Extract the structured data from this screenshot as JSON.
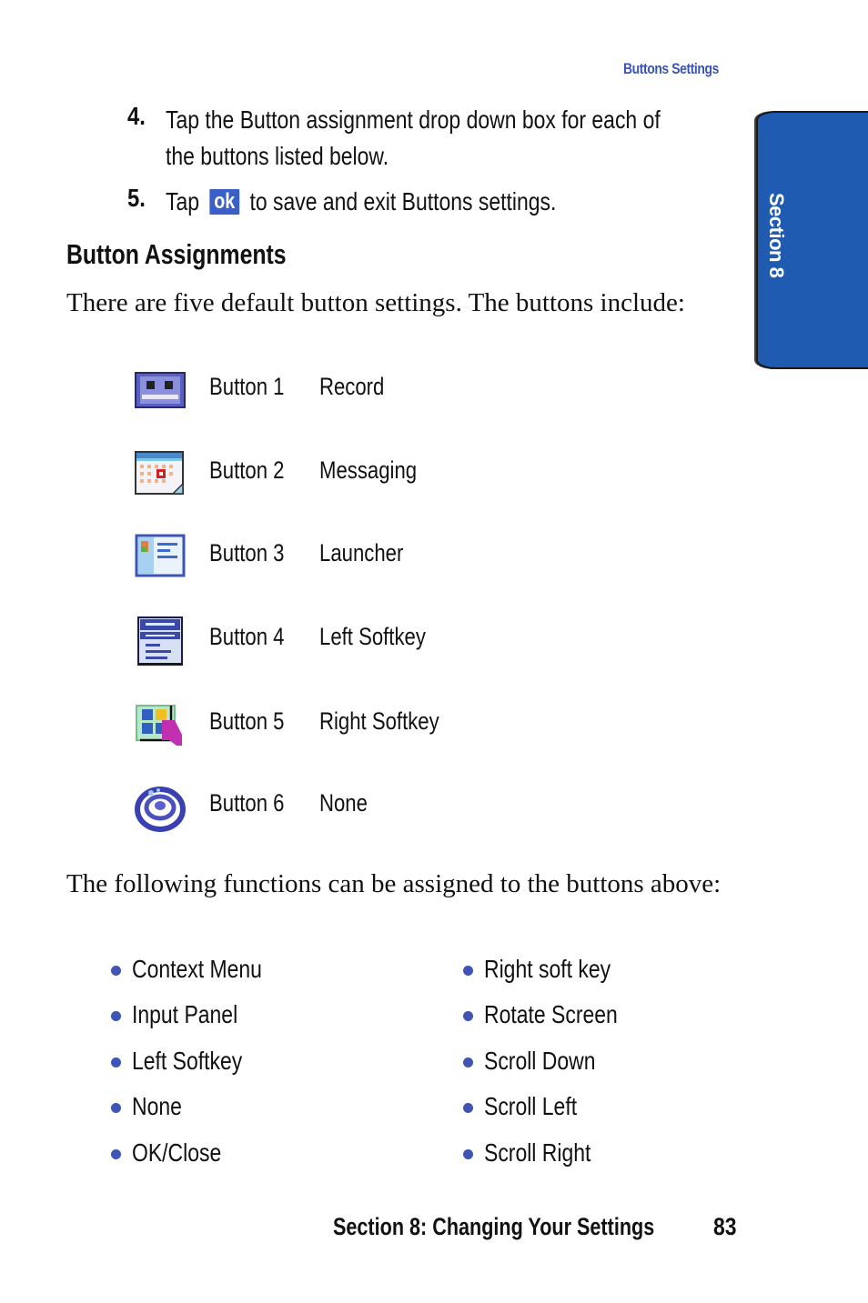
{
  "running_head": "Buttons Settings",
  "section_tab": "Section 8",
  "steps": [
    {
      "number": "4.",
      "line1": "Tap the Button assignment drop down box for each of",
      "line2": "the buttons listed below."
    },
    {
      "number": "5.",
      "before": "Tap",
      "ok_label": "ok",
      "after": "to save and exit Buttons settings."
    }
  ],
  "heading": "Button Assignments",
  "intro": "There are five default button settings. The buttons include:",
  "buttons": [
    {
      "name": "Button 1",
      "value": "Record",
      "icon": "record-icon"
    },
    {
      "name": "Button 2",
      "value": "Messaging",
      "icon": "calendar-icon"
    },
    {
      "name": "Button 3",
      "value": "Launcher",
      "icon": "contacts-icon"
    },
    {
      "name": "Button 4",
      "value": "Left Softkey",
      "icon": "list-icon"
    },
    {
      "name": "Button 5",
      "value": "Right Softkey",
      "icon": "start-menu-icon"
    },
    {
      "name": "Button 6",
      "value": "None",
      "icon": "swirl-icon"
    }
  ],
  "functions_intro": "The following functions can be assigned to the buttons above:",
  "functions_left": [
    "Context Menu",
    "Input Panel",
    "Left Softkey",
    "None",
    "OK/Close"
  ],
  "functions_right": [
    "Right soft key",
    "Rotate Screen",
    "Scroll Down",
    "Scroll Left",
    "Scroll Right"
  ],
  "footer": {
    "title": "Section 8: Changing Your Settings",
    "page": "83"
  },
  "colors": {
    "accent": "#3b55b0",
    "tab": "#1f5bb0",
    "bullet": "#3f55b5"
  }
}
